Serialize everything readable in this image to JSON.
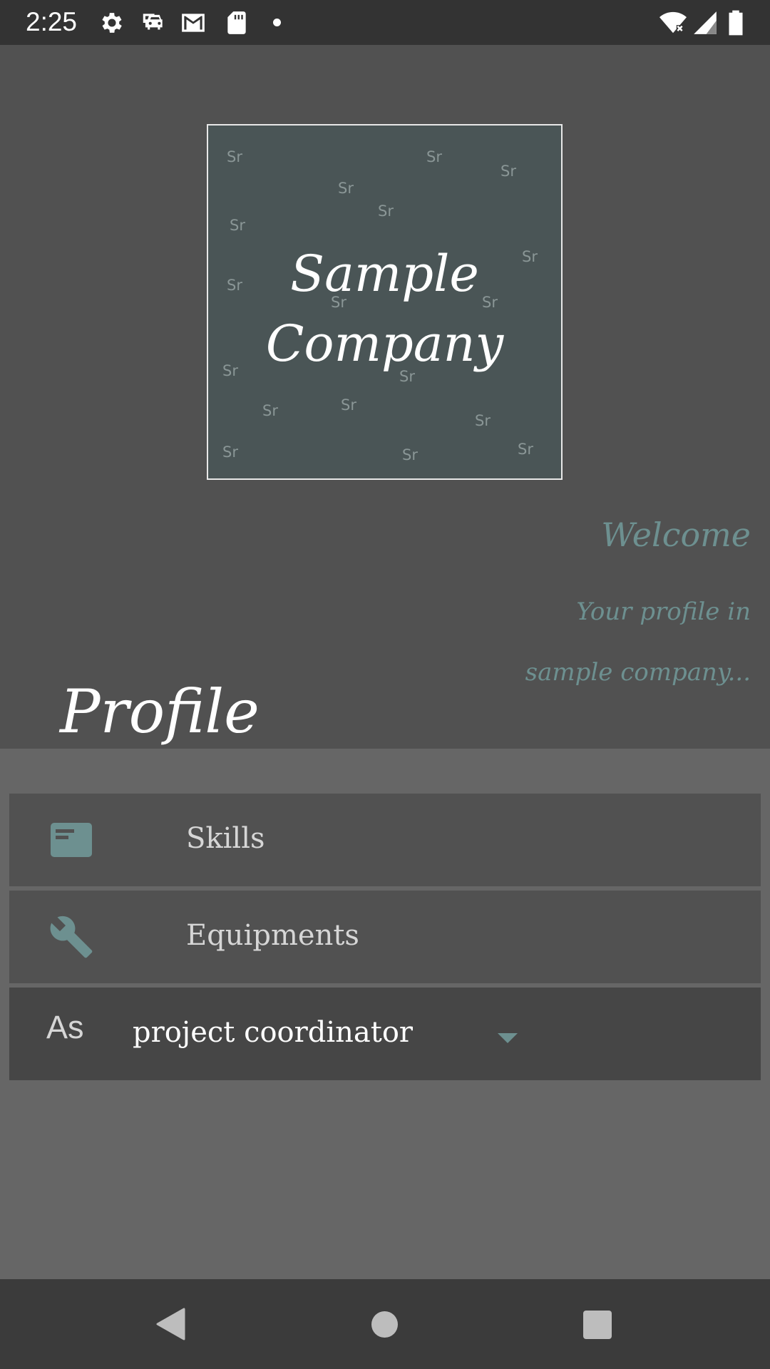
{
  "status_bar": {
    "time": "2:25",
    "icons": [
      "settings-icon",
      "car-icon",
      "gmail-icon",
      "sd-card-icon",
      "notification-dot",
      "wifi-icon",
      "signal-icon",
      "battery-icon"
    ]
  },
  "logo": {
    "line1": "Sample",
    "line2": "Company",
    "watermark": "Sr"
  },
  "header": {
    "welcome": "Welcome",
    "tagline_line1": "Your profile in",
    "tagline_line2": "sample company...",
    "title": "Profile"
  },
  "menu": {
    "skills": {
      "label": "Skills",
      "icon": "card-icon"
    },
    "equipments": {
      "label": "Equipments",
      "icon": "wrench-icon"
    }
  },
  "role": {
    "prefix": "As",
    "selected": "project coordinator"
  },
  "colors": {
    "accent": "#6d9090",
    "header_bg": "#515151",
    "body_bg": "#666666",
    "logo_bg": "#4a5556"
  }
}
